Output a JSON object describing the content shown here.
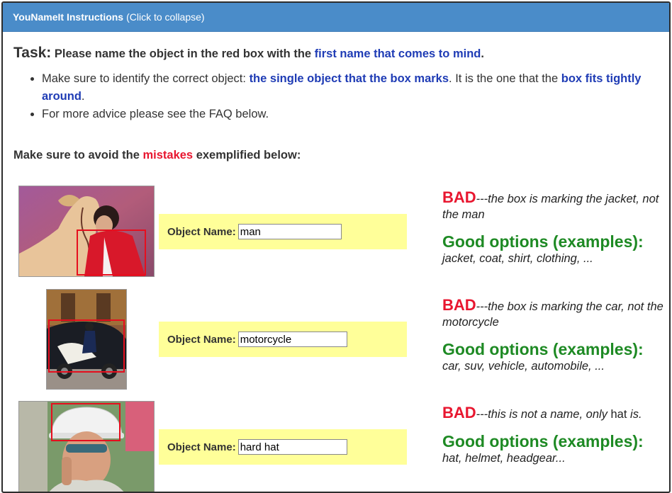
{
  "header": {
    "title": "YouNameIt Instructions",
    "hint": "(Click to collapse)"
  },
  "task": {
    "label": "Task:",
    "text_before": "Please name the object in the red box with the ",
    "highlight": "first name that comes to mind",
    "text_after": "."
  },
  "bullets": [
    {
      "t1": "Make sure to identify the correct object: ",
      "h1": "the single object that the box marks",
      "t2": ". It is the one that the ",
      "h2": "box fits tightly around",
      "t3": "."
    },
    {
      "t1": "For more advice please see the FAQ below."
    }
  ],
  "mistakes_line": {
    "before": "Make sure to avoid the ",
    "highlight": "mistakes",
    "after": " exemplified below:"
  },
  "examples": [
    {
      "label": "Object Name",
      "value": "man",
      "bad_word": "BAD",
      "bad_text": "---the box is marking the jacket, not the man",
      "good_head": "Good options (examples):",
      "good_list": "jacket, coat, shirt, clothing, ..."
    },
    {
      "label": "Object Name",
      "value": "motorcycle",
      "bad_word": "BAD",
      "bad_text": "---the box is marking the car, not the motorcycle",
      "good_head": "Good options (examples):",
      "good_list": "car, suv, vehicle, automobile, ..."
    },
    {
      "label": "Object Name",
      "value": "hard hat",
      "bad_word": "BAD",
      "bad_text_a": "---this is not a name, only ",
      "bad_text_b": "hat",
      "bad_text_c": " is.",
      "good_head": "Good options (examples):",
      "good_list": "hat, helmet, headgear..."
    }
  ],
  "colors": {
    "header_bg": "#4a8cc9",
    "highlight_blue": "#1f3cb5",
    "bad_red": "#e8162f",
    "good_green": "#1e8a24",
    "name_bg": "#ffff99",
    "bbox_red": "#e60e1e"
  }
}
